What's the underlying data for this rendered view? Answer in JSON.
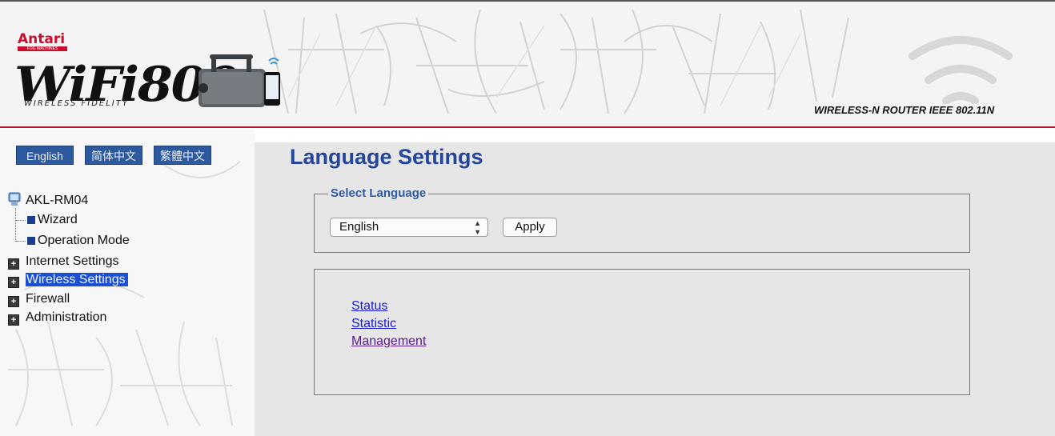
{
  "header": {
    "brand": "Antari",
    "brand_tag": "FOG MACHINES",
    "product_logo": "WiFi800",
    "product_subtitle": "WIRELESS FIDELITY",
    "router_title": "WIRELESS-N ROUTER IEEE 802.11N"
  },
  "sidebar": {
    "languages": [
      "English",
      "简体中文",
      "繁體中文"
    ],
    "tree": {
      "root": "AKL-RM04",
      "leaves": [
        "Wizard",
        "Operation Mode"
      ],
      "nodes": [
        "Internet Settings",
        "Wireless Settings",
        "Firewall",
        "Administration"
      ],
      "selected": "Wireless Settings"
    }
  },
  "main": {
    "title": "Language Settings",
    "fieldset_legend": "Select Language",
    "select_value": "English",
    "apply_label": "Apply",
    "links": [
      "Status",
      "Statistic",
      "Management"
    ]
  },
  "colors": {
    "accent_blue": "#24459a",
    "header_rule": "#b0192b",
    "selected_bg": "#1a4fd6",
    "link_blue": "#1a1ad6",
    "link_visited": "#551a8b"
  }
}
